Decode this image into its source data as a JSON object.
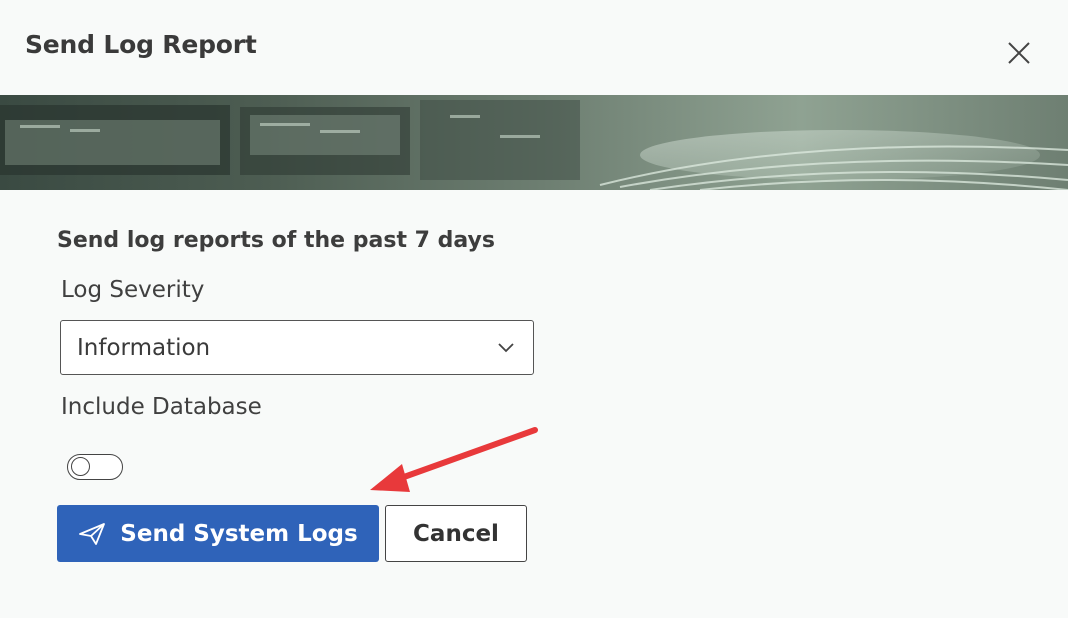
{
  "dialog": {
    "title": "Send Log Report",
    "close_icon": "close-icon"
  },
  "content": {
    "heading": "Send log reports of the past 7 days",
    "severity_label": "Log Severity",
    "severity_value": "Information",
    "database_label": "Include Database",
    "database_toggle_on": false
  },
  "actions": {
    "send_label": "Send System Logs",
    "send_icon": "paper-plane-icon",
    "cancel_label": "Cancel"
  },
  "colors": {
    "primary": "#2f63b9",
    "annotation_arrow": "#e8393b"
  }
}
